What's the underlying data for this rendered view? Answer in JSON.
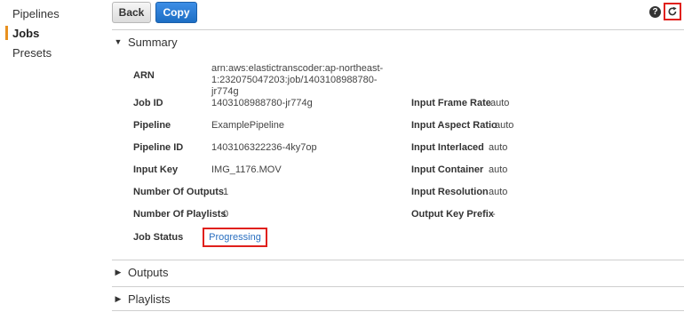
{
  "sidebar": {
    "items": [
      {
        "label": "Pipelines"
      },
      {
        "label": "Jobs"
      },
      {
        "label": "Presets"
      }
    ]
  },
  "toolbar": {
    "back_label": "Back",
    "copy_label": "Copy",
    "help_glyph": "?",
    "refresh_icon": "refresh-icon"
  },
  "colors": {
    "accent": "#e8911f",
    "primary_button": "#1d6ec4",
    "highlight_box": "#e0201c",
    "link": "#2a6fc0"
  },
  "summary": {
    "title": "Summary",
    "arn_label": "ARN",
    "arn_value": "arn:aws:elastictranscoder:ap-northeast-1:232075047203:job/1403108988780-jr774g",
    "left_fields": [
      {
        "label": "Job ID",
        "value": "1403108988780-jr774g"
      },
      {
        "label": "Pipeline",
        "value": "ExamplePipeline"
      },
      {
        "label": "Pipeline ID",
        "value": "1403106322236-4ky7op"
      },
      {
        "label": "Input Key",
        "value": "IMG_1176.MOV"
      },
      {
        "label": "Number Of Outputs",
        "value": "1"
      },
      {
        "label": "Number Of Playlists",
        "value": "0"
      }
    ],
    "right_fields": [
      {
        "label": "Input Frame Rate",
        "value": "auto"
      },
      {
        "label": "Input Aspect Ratio",
        "value": "auto"
      },
      {
        "label": "Input Interlaced",
        "value": "auto"
      },
      {
        "label": "Input Container",
        "value": "auto"
      },
      {
        "label": "Input Resolution",
        "value": "auto"
      },
      {
        "label": "Output Key Prefix",
        "value": "-"
      }
    ],
    "job_status_label": "Job Status",
    "job_status_value": "Progressing"
  },
  "sections": {
    "outputs": "Outputs",
    "playlists": "Playlists"
  }
}
